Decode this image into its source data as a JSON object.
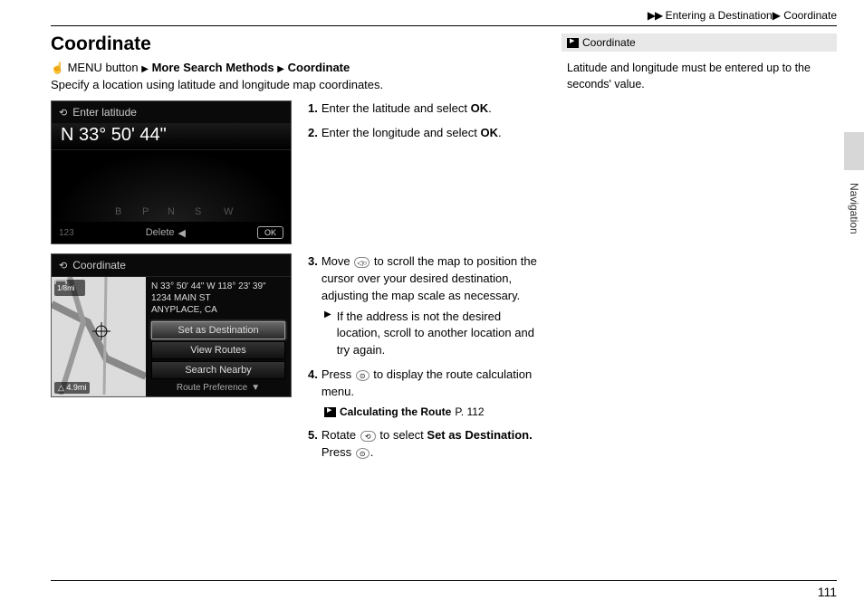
{
  "breadcrumb": {
    "arrows": "▶▶",
    "path1": "Entering a Destination",
    "sep": "▶",
    "path2": "Coordinate"
  },
  "heading": "Coordinate",
  "path": {
    "menu_button": "MENU button",
    "arrow": "▶",
    "more_search": "More Search Methods",
    "coordinate": "Coordinate"
  },
  "description": "Specify a location using latitude and longitude map coordinates.",
  "screen1": {
    "header": "Enter latitude",
    "value": "N 33° 50' 44\"",
    "num123": "123",
    "delete": "Delete",
    "ok": "OK"
  },
  "steps12": [
    {
      "n": "1.",
      "text_pre": "Enter the latitude and select ",
      "bold": "OK",
      "text_post": "."
    },
    {
      "n": "2.",
      "text_pre": "Enter the longitude and select ",
      "bold": "OK",
      "text_post": "."
    }
  ],
  "screen2": {
    "header": "Coordinate",
    "scale": "1/8mi",
    "distance": "4.9mi",
    "coords": "N 33° 50' 44\" W 118° 23' 39\"",
    "street": "1234 MAIN ST",
    "city": "ANYPLACE, CA",
    "menu": {
      "set_dest": "Set as Destination",
      "view_routes": "View Routes",
      "search_nearby": "Search Nearby"
    },
    "route_pref": "Route Preference"
  },
  "step3": {
    "n": "3.",
    "text": "Move ",
    "text2": " to scroll the map to position the cursor over your desired destination, adjusting the map scale as necessary.",
    "sub_arrow": "▶",
    "sub_text": "If the address is not the desired location, scroll to another location and try again."
  },
  "step4": {
    "n": "4.",
    "text_pre": "Press ",
    "text_post": " to display the route calculation menu."
  },
  "ref": {
    "label": "Calculating the Route",
    "page": "P. 112"
  },
  "step5": {
    "n": "5.",
    "text_pre": "Rotate ",
    "text_mid": " to select ",
    "bold": "Set as Destination.",
    "text_post": " Press ",
    "period": "."
  },
  "sidebar": {
    "title": "Coordinate",
    "body": "Latitude and longitude must be entered up to the seconds' value."
  },
  "side_label": "Navigation",
  "page_number": "111"
}
